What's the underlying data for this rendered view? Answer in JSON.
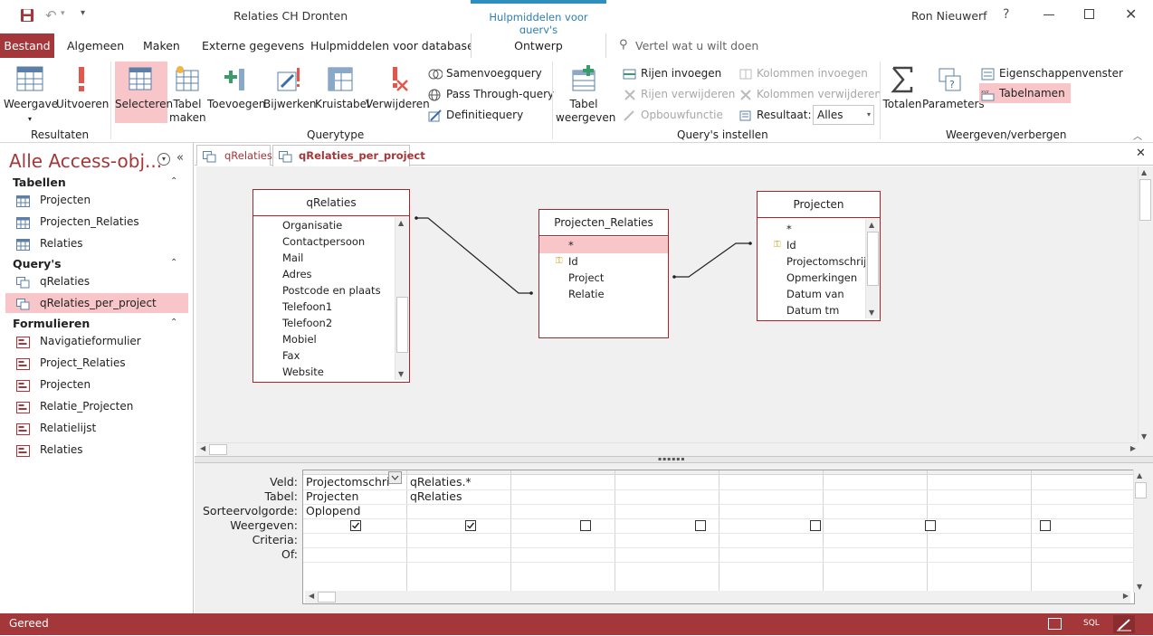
{
  "app": {
    "title": "Relaties CH Dronten",
    "user": "Ron Nieuwerf",
    "context_tab": "Hulpmiddelen voor query's",
    "help": "?"
  },
  "tabs": [
    "Bestand",
    "Algemeen",
    "Maken",
    "Externe gegevens",
    "Hulpmiddelen voor databases",
    "Ontwerp"
  ],
  "tellme": "Vertel wat u wilt doen",
  "ribbon": {
    "resultaten": {
      "label": "Resultaten",
      "weergave": "Weergave",
      "uitvoeren": "Uitvoeren"
    },
    "querytype": {
      "label": "Querytype",
      "selecteren": "Selecteren",
      "tabel_maken_1": "Tabel",
      "tabel_maken_2": "maken",
      "toevoegen": "Toevoegen",
      "bijwerken": "Bijwerken",
      "kruistabel": "Kruistabel",
      "verwijderen": "Verwijderen",
      "samenvoeg": "Samenvoegquery",
      "passthrough": "Pass Through-query",
      "definitie": "Definitiequery"
    },
    "instellen": {
      "label": "Query's instellen",
      "tabel_weergeven_1": "Tabel",
      "tabel_weergeven_2": "weergeven",
      "rijen_invoegen": "Rijen invoegen",
      "rijen_verwijderen": "Rijen verwijderen",
      "opbouwfunctie": "Opbouwfunctie",
      "kolommen_invoegen": "Kolommen invoegen",
      "kolommen_verwijderen": "Kolommen verwijderen",
      "resultaat_label": "Resultaat:",
      "resultaat_value": "Alles"
    },
    "weergeven": {
      "label": "Weergeven/verbergen",
      "totalen": "Totalen",
      "parameters": "Parameters",
      "eigenschappen": "Eigenschappenvenster",
      "tabelnamen": "Tabelnamen"
    }
  },
  "nav": {
    "title": "Alle Access-obj...",
    "groups": [
      {
        "name": "Tabellen",
        "items": [
          "Projecten",
          "Projecten_Relaties",
          "Relaties"
        ]
      },
      {
        "name": "Query's",
        "items": [
          "qRelaties",
          "qRelaties_per_project"
        ]
      },
      {
        "name": "Formulieren",
        "items": [
          "Navigatieformulier",
          "Project_Relaties",
          "Projecten",
          "Relatie_Projecten",
          "Relatielijst",
          "Relaties"
        ]
      }
    ]
  },
  "doc_tabs": [
    "qRelaties",
    "qRelaties_per_project"
  ],
  "tables": [
    {
      "name": "qRelaties",
      "fields": [
        "Organisatie",
        "Contactpersoon",
        "Mail",
        "Adres",
        "Postcode en plaats",
        "Telefoon1",
        "Telefoon2",
        "Mobiel",
        "Fax",
        "Website"
      ]
    },
    {
      "name": "Projecten_Relaties",
      "fields": [
        "*",
        "Id",
        "Project",
        "Relatie"
      ]
    },
    {
      "name": "Projecten",
      "fields": [
        "*",
        "Id",
        "Projectomschrijvi",
        "Opmerkingen",
        "Datum van",
        "Datum tm"
      ]
    }
  ],
  "grid": {
    "labels": [
      "Veld:",
      "Tabel:",
      "Sorteervolgorde:",
      "Weergeven:",
      "Criteria:",
      "Of:"
    ],
    "columns": [
      {
        "veld": "Projectomschri",
        "tabel": "Projecten",
        "sort": "Oplopend",
        "show": true
      },
      {
        "veld": "qRelaties.*",
        "tabel": "qRelaties",
        "sort": "",
        "show": true
      },
      {
        "veld": "",
        "tabel": "",
        "sort": "",
        "show": false
      },
      {
        "veld": "",
        "tabel": "",
        "sort": "",
        "show": false
      },
      {
        "veld": "",
        "tabel": "",
        "sort": "",
        "show": false
      },
      {
        "veld": "",
        "tabel": "",
        "sort": "",
        "show": false
      },
      {
        "veld": "",
        "tabel": "",
        "sort": "",
        "show": false
      },
      {
        "veld": "",
        "tabel": "",
        "sort": "",
        "show": false
      }
    ]
  },
  "status": {
    "text": "Gereed",
    "sql": "SQL"
  },
  "colors": {
    "accent": "#a4373a",
    "selected": "#f8c5c9",
    "context": "#2e8fbf"
  }
}
